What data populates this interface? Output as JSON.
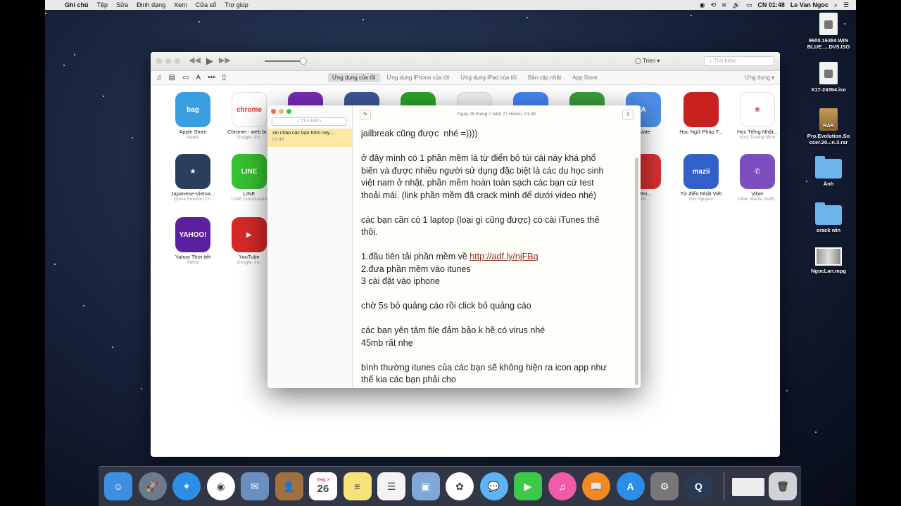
{
  "menubar": {
    "items": [
      "Ghi chú",
      "Tệp",
      "Sửa",
      "Định dạng",
      "Xem",
      "Cửa sổ",
      "Trợ giúp"
    ],
    "time": "CN 01:48",
    "user": "Le Van Ngoc"
  },
  "itunes": {
    "account": "Trien",
    "search_placeholder": "Tìm kiếm",
    "tabs": [
      "Ứng dụng của tôi",
      "Ứng dụng iPhone của tôi",
      "Ứng dụng iPad của tôi",
      "Bản cập nhật",
      "App Store"
    ],
    "right_nav": "Ứng dụng",
    "apps": [
      {
        "name": "Apple Store",
        "dev": "Apple",
        "color": "#3a9fe0",
        "glyph": "bag"
      },
      {
        "name": "Chrome - web br...",
        "dev": "Google, Inc.",
        "color": "#ffffff",
        "glyph": "chrome"
      },
      {
        "name": "",
        "dev": "",
        "color": "#7a2bb8",
        "glyph": ""
      },
      {
        "name": "",
        "dev": "",
        "color": "#3b5998",
        "glyph": "f"
      },
      {
        "name": "",
        "dev": "",
        "color": "#2aa52a",
        "glyph": ""
      },
      {
        "name": "",
        "dev": "",
        "color": "#f2f2f2",
        "glyph": ""
      },
      {
        "name": "",
        "dev": "",
        "color": "#4285f4",
        "glyph": "g"
      },
      {
        "name": "",
        "dev": "",
        "color": "#3a9e3a",
        "glyph": ""
      },
      {
        "name": "nslate",
        "dev": "",
        "color": "#4d8ee8",
        "glyph": "A"
      },
      {
        "name": "Học Ngữ Pháp T...",
        "dev": "",
        "color": "#c92020",
        "glyph": ""
      },
      {
        "name": "Học Tiếng Nhật...",
        "dev": "Khoi Truong Minh",
        "color": "#ffffff",
        "glyph": "❀"
      },
      {
        "name": "Japanese-Vietna...",
        "dev": "Quick Solution Co.",
        "color": "#2b3f5c",
        "glyph": "★"
      },
      {
        "name": "LINE",
        "dev": "LINE Corporation",
        "color": "#36c130",
        "glyph": "LINE"
      },
      {
        "name": "e Tex...",
        "dev": "Inc.",
        "color": "#d83030",
        "glyph": ""
      },
      {
        "name": "Từ điển Nhật Việt",
        "dev": "Ghi Nguyen",
        "color": "#3060c8",
        "glyph": "mazii"
      },
      {
        "name": "Viber",
        "dev": "Viber Media SARL.",
        "color": "#7b4fbf",
        "glyph": "✆"
      },
      {
        "name": "Yahoo Thời tiết",
        "dev": "Yahoo",
        "color": "#5c1fa0",
        "glyph": "YAHOO!"
      },
      {
        "name": "YouTube",
        "dev": "Google, Inc.",
        "color": "#d62828",
        "glyph": "▶"
      }
    ]
  },
  "notes": {
    "search_placeholder": "Tìm kiếm",
    "list_item_title": "xin chào các bạn hôm nay...",
    "list_item_time": "01:48",
    "date": "Ngày 26 tháng 7 năm 27 Heisei, 01:48",
    "lines": [
      "jailbreak cũng được  nhé =))))",
      "",
      "ở đây mình có 1 phần mềm là từ điển bỏ túi cái này khá phổ",
      "biến và được nhiều người sử dụng đặc biệt là các du học sinh",
      "việt nam ở nhật. phần mềm hoàn toàn sạch các bạn cứ test",
      "thoải mái. (link phần mềm đã crack mình để dưới video nhé)",
      "",
      "các bạn cần có 1 laptop (loại gì cũng được) có cài iTunes thế",
      "thôi.",
      "",
      "1.đầu tiên tải phần mềm về ",
      "2.đưa phần mềm vào itunes",
      "3 cài đặt vào iphone",
      "",
      "chờ 5s bỏ quảng cáo rồi click bỏ quảng cáo",
      "",
      "các bạn yên tâm file đảm bảo k hề có virus nhé",
      "45mb rất nhẹ",
      "",
      "bình thường itunes của các bạn sẽ không hiện ra icon app như",
      "thế kia các bạn phải cho"
    ],
    "link": "http://adf.ly/njFBq"
  },
  "desktop": [
    {
      "label": "9600.16384.WIN\nBLUE_...DV5.ISO",
      "kind": "file"
    },
    {
      "label": "X17-24394.iso",
      "kind": "file"
    },
    {
      "label": "Pro.Evolution.So\nccer.20...n.3.rar",
      "kind": "rar"
    },
    {
      "label": "Ảnh",
      "kind": "folder"
    },
    {
      "label": "crack win",
      "kind": "folder"
    },
    {
      "label": "NgocLan.mpg",
      "kind": "video"
    }
  ],
  "dock": [
    {
      "name": "finder",
      "color": "#3d8fe0",
      "glyph": "☺"
    },
    {
      "name": "launchpad",
      "color": "#6b7b8c",
      "glyph": "🚀"
    },
    {
      "name": "safari",
      "color": "#2c8ee8",
      "glyph": "✦"
    },
    {
      "name": "chrome",
      "color": "#ffffff",
      "glyph": "◉"
    },
    {
      "name": "mail",
      "color": "#6a8fbf",
      "glyph": "✉"
    },
    {
      "name": "contacts",
      "color": "#a07040",
      "glyph": "👤"
    },
    {
      "name": "calendar",
      "color": "#ffffff",
      "glyph": "26"
    },
    {
      "name": "notes",
      "color": "#f7e27a",
      "glyph": "≡"
    },
    {
      "name": "reminders",
      "color": "#f4f4f4",
      "glyph": "☰"
    },
    {
      "name": "preview",
      "color": "#7fa8d8",
      "glyph": "▣"
    },
    {
      "name": "photos",
      "color": "#ffffff",
      "glyph": "✿"
    },
    {
      "name": "messages",
      "color": "#5ab4f5",
      "glyph": "💬"
    },
    {
      "name": "facetime",
      "color": "#3ec84a",
      "glyph": "▶"
    },
    {
      "name": "itunes",
      "color": "#f05aa8",
      "glyph": "♫"
    },
    {
      "name": "ibooks",
      "color": "#f28a20",
      "glyph": "📖"
    },
    {
      "name": "app-store",
      "color": "#2a8de8",
      "glyph": "A"
    },
    {
      "name": "system-preferences",
      "color": "#777777",
      "glyph": "⚙"
    },
    {
      "name": "quicktime",
      "color": "#2a3a55",
      "glyph": "Q"
    },
    {
      "name": "minimized-window",
      "color": "#eeeeee",
      "glyph": ""
    },
    {
      "name": "trash",
      "color": "#cfd3d8",
      "glyph": "🗑"
    }
  ],
  "calendar": {
    "month": "THG 7",
    "day": "26"
  }
}
